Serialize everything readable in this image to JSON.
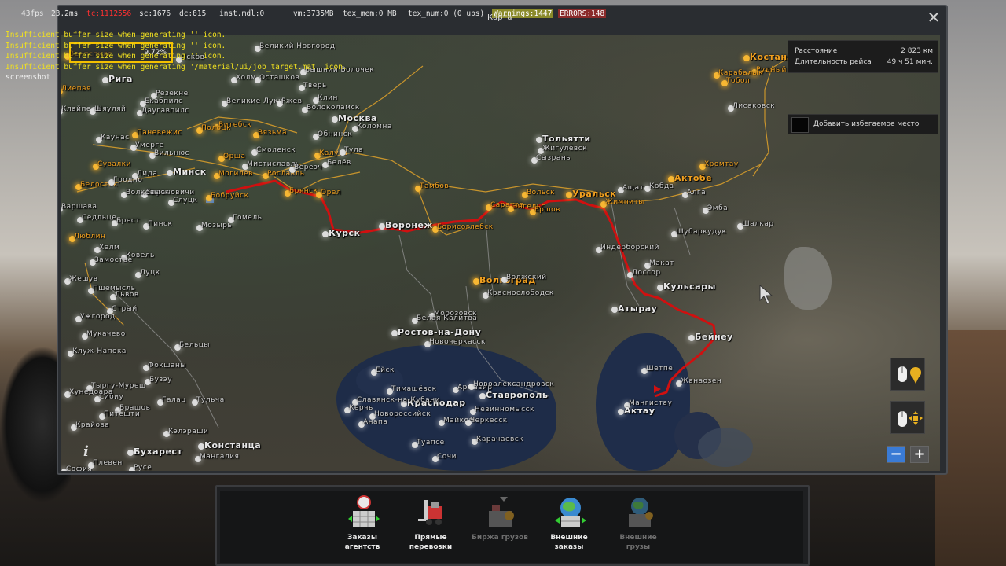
{
  "debug": {
    "fps": "43fps",
    "ms": "23.2ms",
    "tc": "tc:1112556",
    "sc": "sc:1676",
    "dc": "dc:815",
    "inst": "inst.mdl:0",
    "vm": "vm:3735MB",
    "tex_mem": "tex_mem:0  MB",
    "tex_num": "tex_num:0  (0 ups)",
    "warnings": "Warnings:1447",
    "errors": "ERRORS:148",
    "log": [
      "Insufficient buffer size when generating '' icon.",
      "Insufficient buffer size when generating '' icon.",
      "Insufficient buffer size when generating '' icon.",
      "Insufficient buffer size when generating '/material/ui/job_target.mat' icon."
    ],
    "screenshot": "screenshot"
  },
  "search": {
    "label": "Карта",
    "percent": "9.72%"
  },
  "route_info": {
    "distance_label": "Расстояние",
    "distance_value": "2 823 км",
    "duration_label": "Длительность рейса",
    "duration_value": "49 ч 51 мин."
  },
  "avoid_button": {
    "label": "Добавить избегаемое место"
  },
  "map": {
    "cities": [
      {
        "name": "Великий Новгород",
        "style": "normal"
      },
      {
        "name": "Псков",
        "style": "normal"
      },
      {
        "name": "Рига",
        "style": "normal"
      },
      {
        "name": "Резекне",
        "style": "normal"
      },
      {
        "name": "Тверь",
        "style": "normal"
      },
      {
        "name": "Даугавпилс",
        "style": "normal"
      },
      {
        "name": "Витебск",
        "style": "orange"
      },
      {
        "name": "Москва",
        "style": "normal"
      },
      {
        "name": "Коломна",
        "style": "normal"
      },
      {
        "name": "Вязьма",
        "style": "orange"
      },
      {
        "name": "Смоленск",
        "style": "normal"
      },
      {
        "name": "Калуга",
        "style": "orange"
      },
      {
        "name": "Тула",
        "style": "normal"
      },
      {
        "name": "Вильнюс",
        "style": "normal"
      },
      {
        "name": "Минск",
        "style": "normal"
      },
      {
        "name": "Могилёв",
        "style": "orange"
      },
      {
        "name": "Рославль",
        "style": "orange"
      },
      {
        "name": "Брянск",
        "style": "orange"
      },
      {
        "name": "Орел",
        "style": "orange"
      },
      {
        "name": "Тамбов",
        "style": "orange"
      },
      {
        "name": "Тольятти",
        "style": "normal"
      },
      {
        "name": "Жигулёвск",
        "style": "normal"
      },
      {
        "name": "Сызрань",
        "style": "normal"
      },
      {
        "name": "Вольск",
        "style": "orange"
      },
      {
        "name": "Уральск",
        "style": "orange"
      },
      {
        "name": "Саратов",
        "style": "orange"
      },
      {
        "name": "Энгельс",
        "style": "orange"
      },
      {
        "name": "Ершов",
        "style": "orange"
      },
      {
        "name": "Жимпиты",
        "style": "orange"
      },
      {
        "name": "Курск",
        "style": "normal"
      },
      {
        "name": "Воронеж",
        "style": "normal"
      },
      {
        "name": "Борисоглебск",
        "style": "orange"
      },
      {
        "name": "Бобруйск",
        "style": "orange"
      },
      {
        "name": "Гомель",
        "style": "normal"
      },
      {
        "name": "Слуцк",
        "style": "normal"
      },
      {
        "name": "Белосток",
        "style": "orange"
      },
      {
        "name": "Брест",
        "style": "normal"
      },
      {
        "name": "Пинск",
        "style": "normal"
      },
      {
        "name": "Мозырь",
        "style": "normal"
      },
      {
        "name": "Люблин",
        "style": "orange"
      },
      {
        "name": "Ковель",
        "style": "normal"
      },
      {
        "name": "Луцк",
        "style": "normal"
      },
      {
        "name": "Жешув",
        "style": "normal"
      },
      {
        "name": "Львов",
        "style": "normal"
      },
      {
        "name": "Стрый",
        "style": "normal"
      },
      {
        "name": "Волгоград",
        "style": "orange"
      },
      {
        "name": "Волжский",
        "style": "normal"
      },
      {
        "name": "Краснослободск",
        "style": "normal"
      },
      {
        "name": "Ростов-на-Дону",
        "style": "normal"
      },
      {
        "name": "Ставрополь",
        "style": "normal"
      },
      {
        "name": "Краснодар",
        "style": "normal"
      },
      {
        "name": "Майкоп",
        "style": "normal"
      },
      {
        "name": "Констанца",
        "style": "normal"
      },
      {
        "name": "Мангалия",
        "style": "normal"
      },
      {
        "name": "Клуж-Напока",
        "style": "normal"
      },
      {
        "name": "Брашов",
        "style": "normal"
      },
      {
        "name": "Галац",
        "style": "normal"
      },
      {
        "name": "Питешти",
        "style": "normal"
      },
      {
        "name": "Крайова",
        "style": "normal"
      },
      {
        "name": "Бухарест",
        "style": "normal"
      },
      {
        "name": "София",
        "style": "normal"
      },
      {
        "name": "Русе",
        "style": "normal"
      },
      {
        "name": "Бельцы",
        "style": "normal"
      },
      {
        "name": "Атырау",
        "style": "normal"
      },
      {
        "name": "Кульсары",
        "style": "normal"
      },
      {
        "name": "Бейнеу",
        "style": "normal"
      },
      {
        "name": "Жанаозен",
        "style": "normal"
      },
      {
        "name": "Мангистау",
        "style": "normal"
      },
      {
        "name": "Актау",
        "style": "normal"
      },
      {
        "name": "Шетпе",
        "style": "normal"
      },
      {
        "name": "Актобе",
        "style": "orange"
      },
      {
        "name": "Хромтау",
        "style": "orange"
      },
      {
        "name": "Алга",
        "style": "normal"
      },
      {
        "name": "Эмба",
        "style": "normal"
      },
      {
        "name": "Шалкар",
        "style": "normal"
      },
      {
        "name": "Костанай",
        "style": "orange"
      },
      {
        "name": "Рудный",
        "style": "orange"
      },
      {
        "name": "Лисаковск",
        "style": "normal"
      },
      {
        "name": "Вентспилс",
        "style": "orange"
      },
      {
        "name": "Лиепая",
        "style": "orange"
      },
      {
        "name": "Клайпеда",
        "style": "normal"
      },
      {
        "name": "Шяуляй",
        "style": "normal"
      },
      {
        "name": "Паневежис",
        "style": "orange"
      },
      {
        "name": "Каунас",
        "style": "normal"
      },
      {
        "name": "Сувалки",
        "style": "orange"
      },
      {
        "name": "Седльце",
        "style": "normal"
      },
      {
        "name": "Варшава",
        "style": "normal"
      },
      {
        "name": "Тыргу-Муреш",
        "style": "normal"
      },
      {
        "name": "Великие Луки",
        "style": "normal"
      },
      {
        "name": "Ржев",
        "style": "normal"
      },
      {
        "name": "Обнинск",
        "style": "normal"
      },
      {
        "name": "Орша",
        "style": "orange"
      },
      {
        "name": "Клин",
        "style": "normal"
      },
      {
        "name": "Волоколамск",
        "style": "normal"
      },
      {
        "name": "Вышний Волочек",
        "style": "normal"
      },
      {
        "name": "Холм",
        "style": "normal"
      },
      {
        "name": "Осташков",
        "style": "normal"
      },
      {
        "name": "Индерборский",
        "style": "normal"
      },
      {
        "name": "Доссор",
        "style": "normal"
      },
      {
        "name": "Макат",
        "style": "normal"
      },
      {
        "name": "Шубаркудук",
        "style": "normal"
      },
      {
        "name": "Кобда",
        "style": "normal"
      },
      {
        "name": "Ащат",
        "style": "normal"
      },
      {
        "name": "Карабалык",
        "style": "orange"
      },
      {
        "name": "Тобол",
        "style": "orange"
      },
      {
        "name": "Ейск",
        "style": "normal"
      },
      {
        "name": "Морозовск",
        "style": "normal"
      },
      {
        "name": "Белая Калитва",
        "style": "normal"
      },
      {
        "name": "Новочеркасск",
        "style": "normal"
      },
      {
        "name": "Армавир",
        "style": "normal"
      },
      {
        "name": "Невинномысск",
        "style": "normal"
      },
      {
        "name": "Черкесск",
        "style": "normal"
      },
      {
        "name": "Новоалександровск",
        "style": "normal"
      },
      {
        "name": "Туапсе",
        "style": "normal"
      },
      {
        "name": "Сочи",
        "style": "normal"
      },
      {
        "name": "Тимашёвск",
        "style": "normal"
      },
      {
        "name": "Славянск-на-Кубани",
        "style": "normal"
      },
      {
        "name": "Новороссийск",
        "style": "normal"
      },
      {
        "name": "Анапа",
        "style": "normal"
      },
      {
        "name": "Керчь",
        "style": "normal"
      },
      {
        "name": "Карачаевск",
        "style": "normal"
      },
      {
        "name": "Мукачево",
        "style": "normal"
      },
      {
        "name": "Ужгород",
        "style": "normal"
      },
      {
        "name": "Фокшаны",
        "style": "normal"
      },
      {
        "name": "Бузэу",
        "style": "normal"
      },
      {
        "name": "Сибиу",
        "style": "normal"
      },
      {
        "name": "Хунедоара",
        "style": "normal"
      },
      {
        "name": "Тульча",
        "style": "normal"
      },
      {
        "name": "Кэлэраши",
        "style": "normal"
      },
      {
        "name": "Плевен",
        "style": "normal"
      },
      {
        "name": "Мистиславль",
        "style": "normal"
      },
      {
        "name": "Белёв",
        "style": "normal"
      },
      {
        "name": "Вереэч",
        "style": "normal"
      },
      {
        "name": "Замостье",
        "style": "normal"
      },
      {
        "name": "Пшемысль",
        "style": "normal"
      },
      {
        "name": "Хелм",
        "style": "normal"
      },
      {
        "name": "Умерге",
        "style": "normal"
      },
      {
        "name": "Гродно",
        "style": "normal"
      },
      {
        "name": "Барановичи",
        "style": "normal"
      },
      {
        "name": "Волковыск",
        "style": "normal"
      },
      {
        "name": "Лида",
        "style": "normal"
      },
      {
        "name": "Екабпилс",
        "style": "normal"
      },
      {
        "name": "Полоцк",
        "style": "orange"
      }
    ]
  },
  "controls": {
    "info": "i",
    "zoom_out": "−",
    "zoom_in": "+",
    "close": "✕"
  },
  "bottom_menu": [
    {
      "label": "Заказы агентств",
      "enabled": true,
      "icon": "agency-jobs-icon"
    },
    {
      "label": "Прямые перевозки",
      "enabled": true,
      "icon": "forklift-icon"
    },
    {
      "label": "Биржа грузов",
      "enabled": false,
      "icon": "freight-market-icon"
    },
    {
      "label": "Внешние заказы",
      "enabled": true,
      "icon": "globe-cargo-icon"
    },
    {
      "label": "Внешние грузы",
      "enabled": false,
      "icon": "globe-cargo-disabled-icon"
    }
  ],
  "colors": {
    "route": "#d01010",
    "road": "#e8a020",
    "accent": "#f4c000",
    "zoom_blue": "#3a7bd5"
  }
}
